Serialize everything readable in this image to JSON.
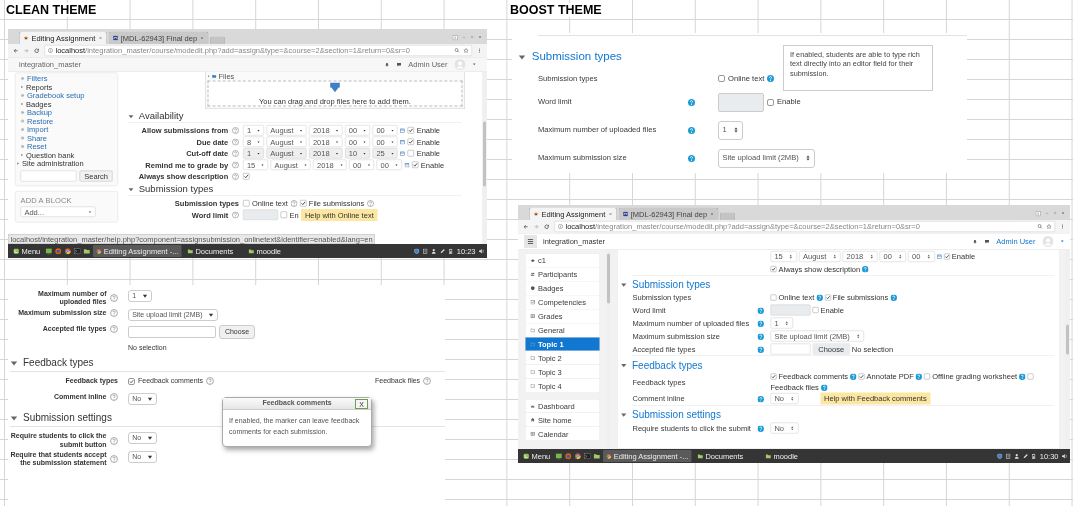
{
  "clean_title": "CLEAN THEME",
  "boost_title": "BOOST THEME",
  "clean_browser": {
    "tabs": [
      {
        "label": "Editing Assignment",
        "selected": true
      },
      {
        "label": "[MDL-62943] Final dep",
        "selected": false
      }
    ],
    "url_host": "localhost",
    "url_path": "/integration_master/course/modedit.php?add=assign&type=&course=2&section=1&return=0&sr=0",
    "site_name": "integration_master",
    "user": "Admin User",
    "nav": [
      {
        "label": "Filters",
        "kind": "link"
      },
      {
        "label": "Reports",
        "kind": "branch"
      },
      {
        "label": "Gradebook setup",
        "kind": "link"
      },
      {
        "label": "Badges",
        "kind": "branch"
      },
      {
        "label": "Backup",
        "kind": "link"
      },
      {
        "label": "Restore",
        "kind": "link"
      },
      {
        "label": "Import",
        "kind": "link"
      },
      {
        "label": "Share",
        "kind": "link"
      },
      {
        "label": "Reset",
        "kind": "link"
      },
      {
        "label": "Question bank",
        "kind": "branch"
      }
    ],
    "site_admin": "Site administration",
    "search_button": "Search",
    "block_title": "ADD A BLOCK",
    "block_select": "Add...",
    "files_label": "Files",
    "files_hint": "You can drag and drop files here to add them.",
    "form": [
      {
        "kind": "section",
        "title": "Availability",
        "expanded": true
      },
      {
        "kind": "date",
        "label": "Allow submissions from",
        "fields": [
          "1",
          "August",
          "2018",
          "00",
          "00"
        ],
        "enable": "Enable",
        "enabled": true
      },
      {
        "kind": "date",
        "label": "Due date",
        "fields": [
          "8",
          "August",
          "2018",
          "00",
          "00"
        ],
        "enable": "Enable",
        "enabled": true
      },
      {
        "kind": "date",
        "label": "Cut-off date",
        "fields": [
          "1",
          "August",
          "2018",
          "10",
          "25"
        ],
        "enable": "Enable",
        "enabled": false
      },
      {
        "kind": "date",
        "label": "Remind me to grade by",
        "fields": [
          "15",
          "August",
          "2018",
          "00",
          "00"
        ],
        "enable": "Enable",
        "enabled": true
      },
      {
        "kind": "checkbox",
        "label": "Always show description",
        "checked": true
      },
      {
        "kind": "section",
        "title": "Submission types",
        "expanded": true
      },
      {
        "kind": "choices",
        "label": "Submission types",
        "options": [
          {
            "label": "Online text",
            "checked": false
          },
          {
            "label": "File submissions",
            "checked": true
          }
        ]
      },
      {
        "kind": "word_limit",
        "label": "Word limit",
        "enable": "En",
        "enabled": false,
        "tooltip": "Help with Online text"
      }
    ],
    "status_url": "localhost/integration_master/help.php?component=assignsubmission_onlinetext&identifier=enabled&lang=en",
    "taskbar": {
      "menu": "Menu",
      "windows": [
        {
          "label": "Editing Assignment -...",
          "selected": true
        },
        {
          "label": "Documents",
          "selected": false
        },
        {
          "label": "moodle",
          "selected": false
        }
      ],
      "time": "10:23"
    }
  },
  "clean_form": {
    "form": [
      {
        "kind": "select",
        "label": "Maximum number of uploaded files",
        "value": "1"
      },
      {
        "kind": "select",
        "label": "Maximum submission size",
        "value": "Site upload limit (2MB)"
      },
      {
        "kind": "filetypes",
        "label": "Accepted file types",
        "button": "Choose",
        "note": "No selection"
      },
      {
        "kind": "section",
        "title": "Feedback types",
        "expanded": true
      },
      {
        "kind": "choices",
        "label": "Feedback types",
        "options": [
          {
            "label": "Feedback comments",
            "checked": true
          },
          {
            "label": "Feedback files"
          }
        ]
      },
      {
        "kind": "select",
        "label": "Comment inline",
        "value": "No"
      },
      {
        "kind": "section",
        "title": "Submission settings",
        "expanded": true
      },
      {
        "kind": "select",
        "label": "Require students to click the submit button",
        "value": "No"
      },
      {
        "kind": "select",
        "label": "Require that students accept the submission statement",
        "value": "No"
      }
    ],
    "popup": {
      "title": "Feedback comments",
      "close": "X",
      "text": "If enabled, the marker can leave feedback comments for each submission."
    }
  },
  "boost_form": {
    "form": [
      {
        "kind": "section",
        "title": "Submission types",
        "expanded": true
      },
      {
        "kind": "choices",
        "label": "Submission types",
        "options": [
          {
            "label": "Online text",
            "checked": false
          }
        ]
      },
      {
        "kind": "word_limit",
        "label": "Word limit",
        "enable": "Enable",
        "enabled": false
      },
      {
        "kind": "select",
        "label": "Maximum number of uploaded files",
        "value": "1"
      },
      {
        "kind": "select",
        "label": "Maximum submission size",
        "value": "Site upload limit (2MB)"
      }
    ],
    "popover": "If enabled, students are able to type rich text directly into an editor field for their submission."
  },
  "boost_browser": {
    "tabs": [
      {
        "label": "Editing Assignment",
        "selected": true
      },
      {
        "label": "[MDL-62943] Final dep",
        "selected": false
      }
    ],
    "url_host": "localhost",
    "url_path": "/integration_master/course/modedit.php?add=assign&type=&course=2&section=1&return=0&sr=0",
    "site_name": "integration_master",
    "user": "Admin User",
    "nav": [
      {
        "label": "c1",
        "selected": false
      },
      {
        "label": "Participants",
        "selected": false
      },
      {
        "label": "Badges",
        "selected": false
      },
      {
        "label": "Competencies",
        "selected": false
      },
      {
        "label": "Grades",
        "selected": false
      },
      {
        "label": "General",
        "selected": false
      },
      {
        "label": "Topic 1",
        "selected": true
      },
      {
        "label": "Topic 2",
        "selected": false
      },
      {
        "label": "Topic 3",
        "selected": false
      },
      {
        "label": "Topic 4",
        "selected": false
      }
    ],
    "nav2": [
      {
        "label": "Dashboard",
        "selected": false
      },
      {
        "label": "Site home",
        "selected": false
      },
      {
        "label": "Calendar",
        "selected": false
      }
    ],
    "form": [
      {
        "kind": "date",
        "fields": [
          "15",
          "August",
          "2018",
          "00",
          "00"
        ],
        "enable": "Enable",
        "enabled": true
      },
      {
        "kind": "check_option",
        "label": "Always show description",
        "checked": true
      },
      {
        "kind": "section",
        "title": "Submission types",
        "expanded": true
      },
      {
        "kind": "choices",
        "label": "Submission types",
        "options": [
          {
            "label": "Online text",
            "checked": false
          },
          {
            "label": "File submissions",
            "checked": true
          }
        ]
      },
      {
        "kind": "word_limit",
        "label": "Word limit",
        "enable": "Enable",
        "enabled": false
      },
      {
        "kind": "select",
        "label": "Maximum number of uploaded files",
        "value": "1"
      },
      {
        "kind": "select",
        "label": "Maximum submission size",
        "value": "Site upload limit (2MB)"
      },
      {
        "kind": "filetypes",
        "label": "Accepted file types",
        "button": "Choose",
        "note": "No selection"
      },
      {
        "kind": "section",
        "title": "Feedback types",
        "expanded": true
      },
      {
        "kind": "choices",
        "label": "Feedback types",
        "options": [
          {
            "label": "Feedback comments",
            "checked": true
          },
          {
            "label": "Annotate PDF",
            "checked": true
          },
          {
            "label": "Offline grading worksheet",
            "checked": false
          },
          {
            "label": "Feedback files",
            "checked": false
          }
        ]
      },
      {
        "kind": "select",
        "label": "Comment inline",
        "value": "No",
        "tooltip": "Help with Feedback comments"
      },
      {
        "kind": "section",
        "title": "Submission settings",
        "expanded": true
      },
      {
        "kind": "select",
        "label": "Require students to click the submit",
        "value": "No"
      }
    ],
    "taskbar": {
      "menu": "Menu",
      "windows": [
        {
          "label": "Editing Assignment -...",
          "selected": true
        },
        {
          "label": "Documents",
          "selected": false
        },
        {
          "label": "moodle",
          "selected": false
        }
      ],
      "time": "10:30"
    }
  }
}
